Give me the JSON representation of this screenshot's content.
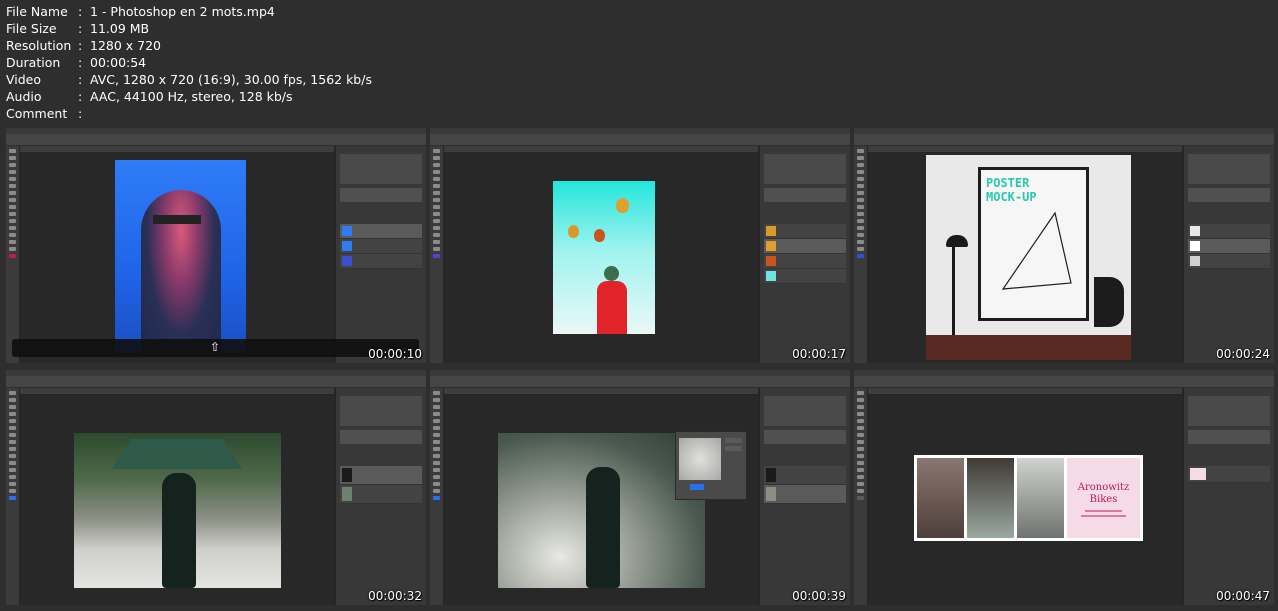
{
  "info": {
    "rows": [
      {
        "key": "File Name",
        "sep": ":",
        "value": "1 - Photoshop en 2 mots.mp4"
      },
      {
        "key": "File Size",
        "sep": ":",
        "value": "11.09 MB"
      },
      {
        "key": "Resolution",
        "sep": ":",
        "value": "1280 x 720"
      },
      {
        "key": "Duration",
        "sep": ":",
        "value": "00:00:54"
      },
      {
        "key": "Video",
        "sep": ":",
        "value": "AVC, 1280 x 720 (16:9), 30.00 fps, 1562 kb/s"
      },
      {
        "key": "Audio",
        "sep": ":",
        "value": "AAC, 44100 Hz, stereo, 128 kb/s"
      },
      {
        "key": "Comment",
        "sep": ":",
        "value": ""
      }
    ]
  },
  "thumbnails": [
    {
      "timestamp": "00:00:10"
    },
    {
      "timestamp": "00:00:17"
    },
    {
      "timestamp": "00:00:24",
      "poster_line1": "POSTER",
      "poster_line2": "MOCK-UP"
    },
    {
      "timestamp": "00:00:32"
    },
    {
      "timestamp": "00:00:39"
    },
    {
      "timestamp": "00:00:47",
      "brand_line1": "Aronowitz",
      "brand_line2": "Bikes"
    }
  ],
  "colors": {
    "background": "#2e2e2e",
    "ps_dark": "#282828",
    "accent_blue": "#2a6ff0",
    "accent_cyan": "#2fe0d8",
    "poster_text": "#28c9b0",
    "brand_pink": "#c2185b"
  }
}
